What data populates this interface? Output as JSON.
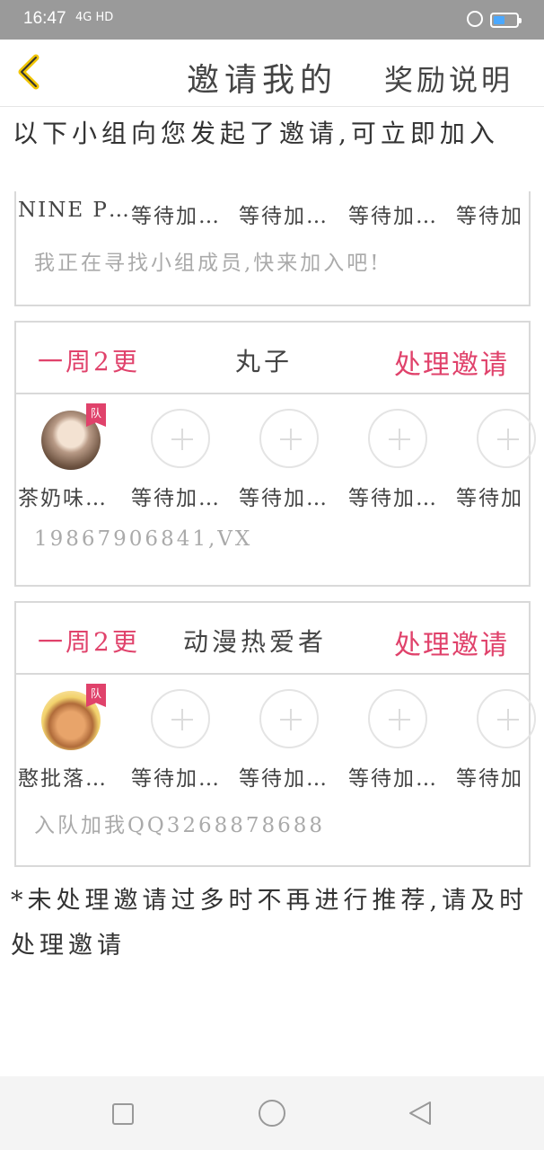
{
  "status": {
    "time": "16:47",
    "network": "4G HD"
  },
  "header": {
    "title": "邀请我的",
    "rewards_link": "奖励说明"
  },
  "intro": "以下小组向您发起了邀请,可立即加入",
  "groups": [
    {
      "members": [
        "NINE P…",
        "等待加…",
        "等待加…",
        "等待加…",
        "等待加"
      ],
      "message": "我正在寻找小组成员,快来加入吧!"
    },
    {
      "frequency": "一周2更",
      "name": "丸子",
      "action": "处理邀请",
      "badge": "队",
      "members": [
        "茶奶味…",
        "等待加…",
        "等待加…",
        "等待加…",
        "等待加"
      ],
      "message": "19867906841,VX"
    },
    {
      "frequency": "一周2更",
      "name": "动漫热爱者",
      "action": "处理邀请",
      "badge": "队",
      "members": [
        "憨批落…",
        "等待加…",
        "等待加…",
        "等待加…",
        "等待加"
      ],
      "message": "入队加我QQ3268878688"
    }
  ],
  "footnote": "*未处理邀请过多时不再进行推荐,请及时处理邀请",
  "icons": {
    "back": "chevron-left-icon",
    "slot": "plus-icon",
    "nav_recent": "square-icon",
    "nav_home": "circle-icon",
    "nav_back": "triangle-back-icon"
  },
  "colors": {
    "accent": "#e0426b",
    "back_arrow": "#f0c400",
    "battery": "#4aa8ff"
  },
  "battery_level": 0.5
}
